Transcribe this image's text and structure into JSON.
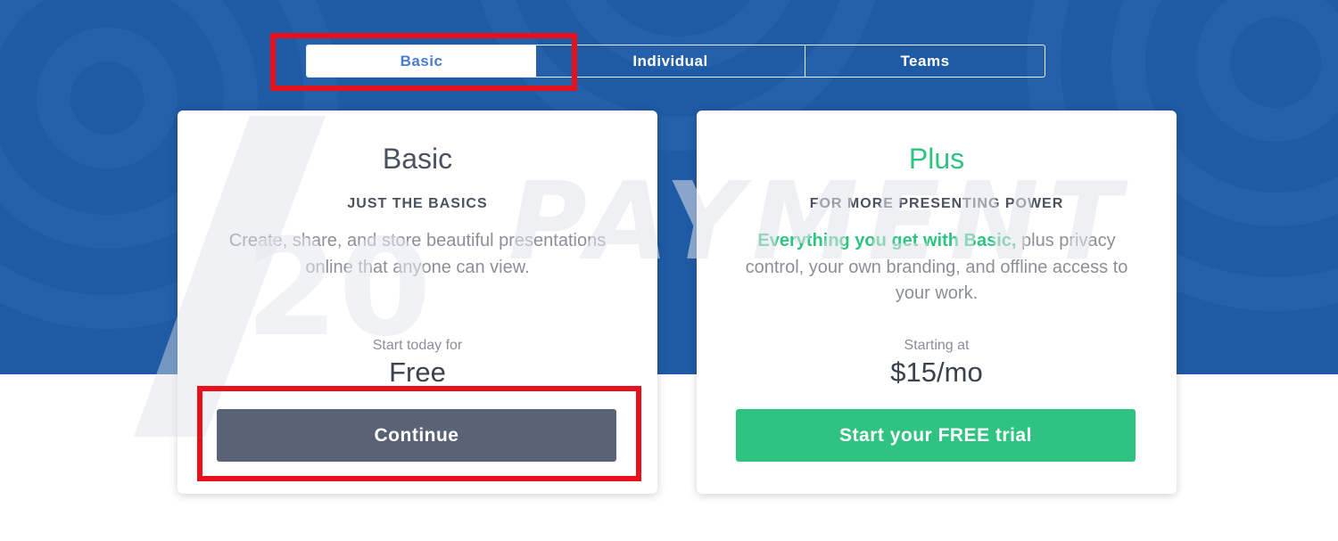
{
  "tabs": [
    {
      "label": "Basic",
      "selected": true
    },
    {
      "label": "Individual",
      "selected": false
    },
    {
      "label": "Teams",
      "selected": false
    }
  ],
  "plans": [
    {
      "name": "Basic",
      "tagline": "JUST THE BASICS",
      "description": "Create, share, and store beautiful presentations online that anyone can view.",
      "price_label": "Start today for",
      "price": "Free",
      "cta_label": "Continue"
    },
    {
      "name": "Plus",
      "tagline": "FOR MORE PRESENTING POWER",
      "description_highlight": "Everything you get with Basic,",
      "description_rest": " plus privacy control, your own branding, and offline access to your work.",
      "price_label": "Starting at",
      "price": "$15/mo",
      "cta_label": "Start your FREE trial"
    }
  ],
  "watermark": {
    "text": "PAYMENT",
    "number": "20"
  },
  "colors": {
    "hero_background": "#1f5aa4",
    "accent_green": "#2fc381",
    "tab_selected_text": "#4b7bd1",
    "continue_button": "#5a6375",
    "annotation_red": "#e8101a"
  }
}
